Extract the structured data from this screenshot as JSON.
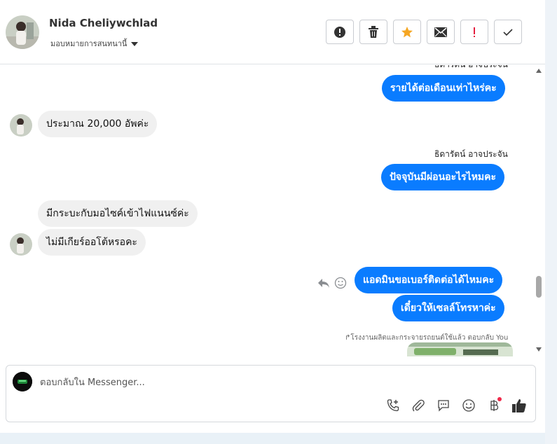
{
  "header": {
    "name": "Nida Cheliywchlad",
    "subtitle": "มอบหมายการสนทนานี้"
  },
  "messages": {
    "partial_sender": "ธิดารัตน์ อาจประจัน",
    "m1": "รายได้ต่อเดือนเท่าไหร่คะ",
    "m2": "ประมาณ 20,000 อัพค่ะ",
    "sender2": "ธิดารัตน์ อาจประจัน",
    "m3": "ปัจจุบันมีผ่อนอะไรไหมคะ",
    "m4": "มีกระบะกับมอไซค์เข้าไฟแนนซ์ค่ะ",
    "m5": "ไม่มีเกียร์ออโต้หรอคะ",
    "m6": "แอดมินขอเบอร์ติดต่อได้ไหมคะ",
    "m7": "เดี๋ยวให้เซลล์โทรหาค่ะ",
    "reply_note": "โรงงานผลิตและกระจายรถยนต์ใช้แล้ว ตอบกลับ You"
  },
  "composer": {
    "placeholder": "ตอบกลับใน Messenger..."
  },
  "icons": {
    "report": "alert-circle-icon",
    "delete": "trash-icon",
    "star": "star-icon",
    "mail": "envelope-icon",
    "important": "exclamation-icon",
    "done": "check-icon"
  },
  "colors": {
    "accent": "#0a7cff",
    "star": "#f5a623",
    "important": "#e41e3f"
  }
}
